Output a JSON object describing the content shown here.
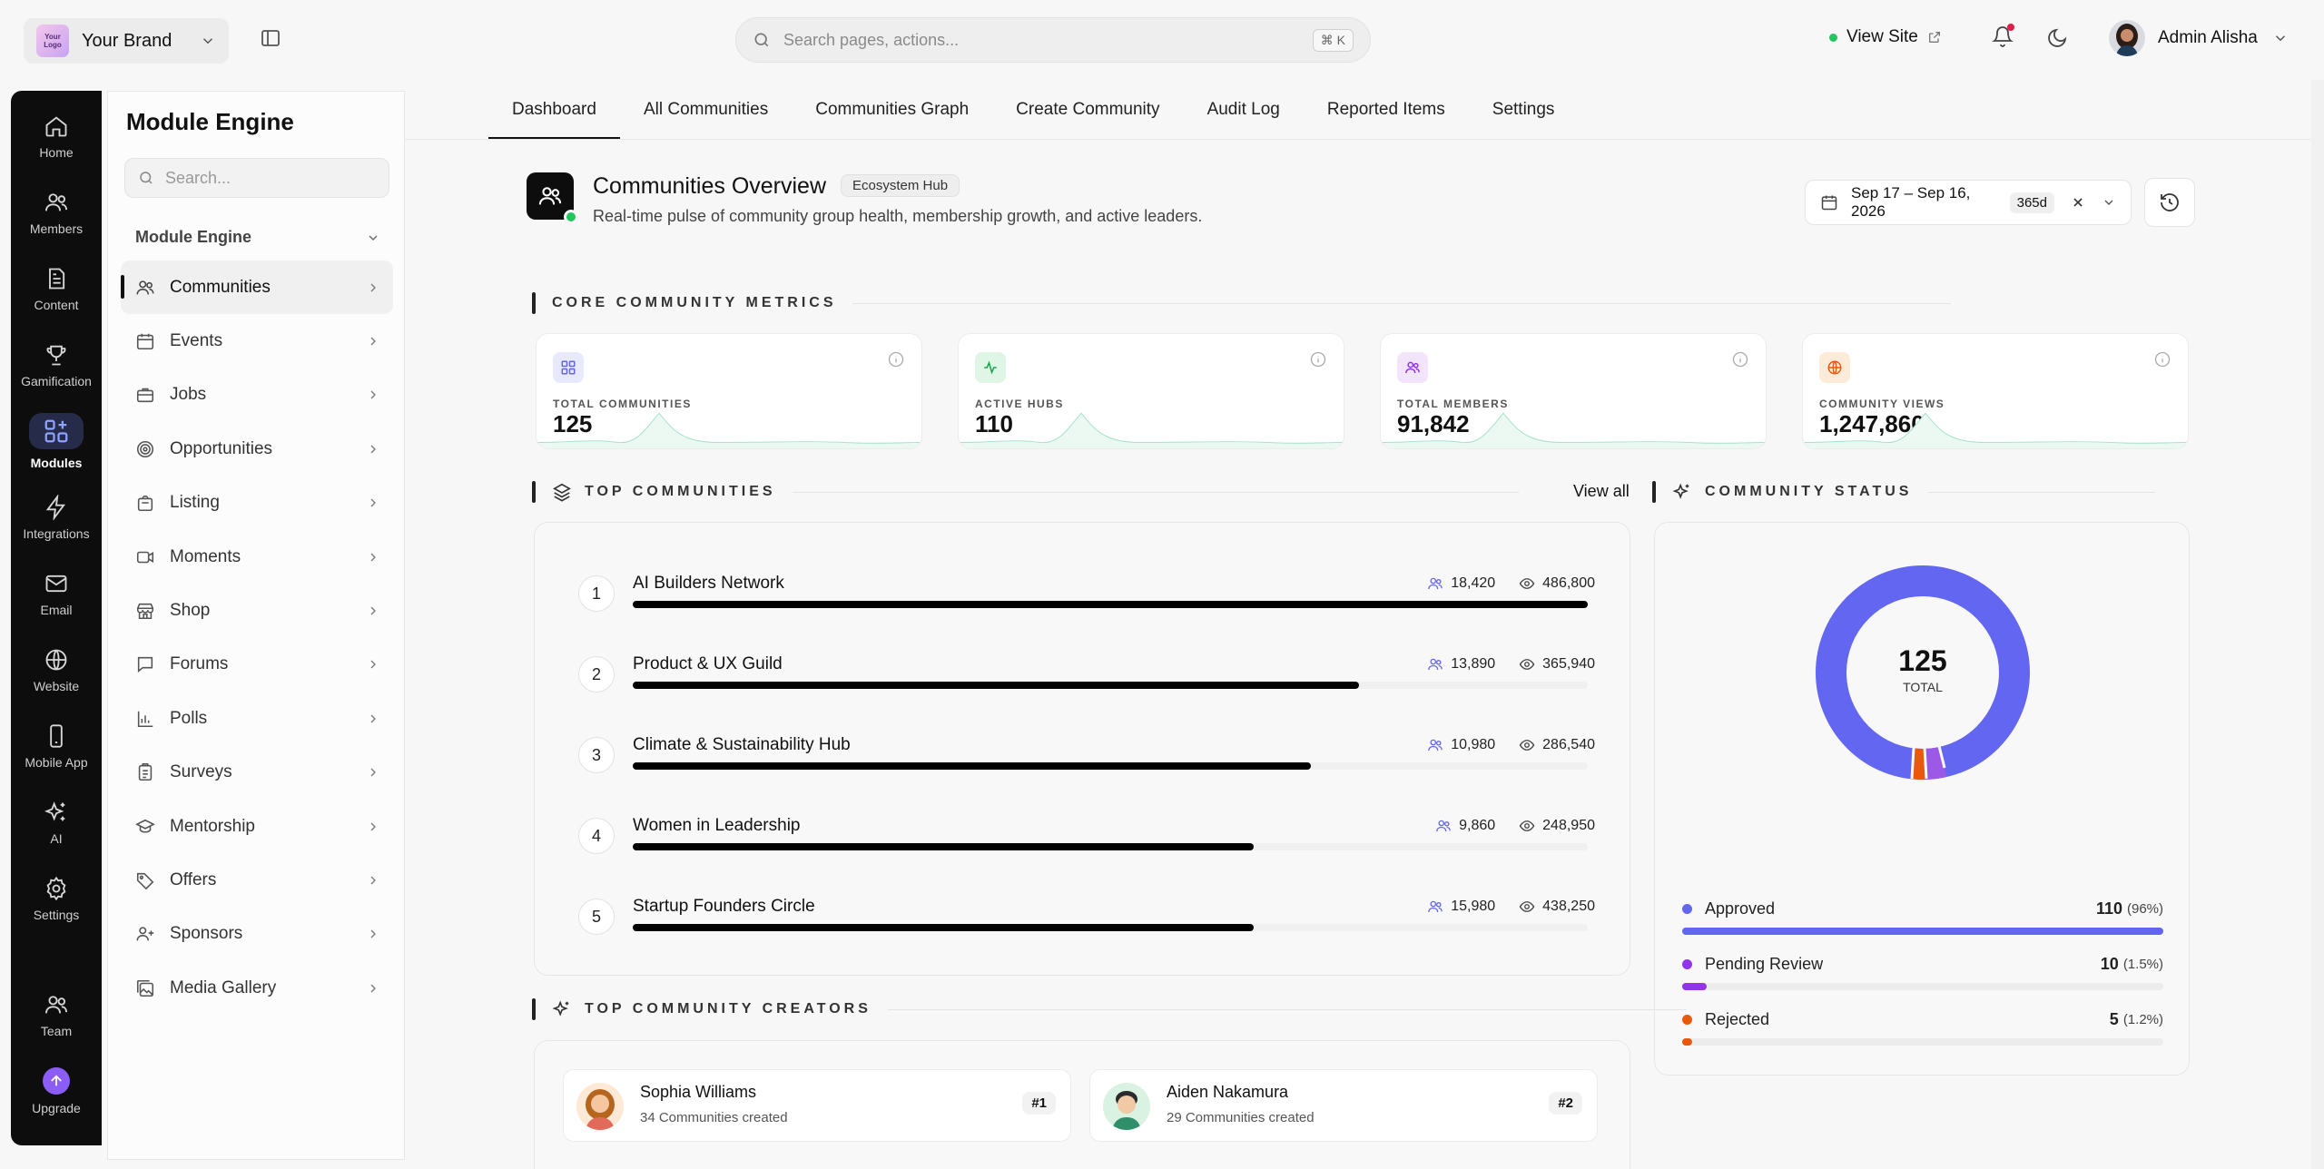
{
  "topbar": {
    "brand_logo_text": "Your Logo",
    "brand_name": "Your Brand",
    "search_placeholder": "Search pages, actions...",
    "search_shortcut": "⌘ K",
    "view_site": "View Site",
    "user_name": "Admin Alisha"
  },
  "rail": {
    "items": [
      {
        "label": "Home",
        "icon": "home-icon"
      },
      {
        "label": "Members",
        "icon": "members-icon"
      },
      {
        "label": "Content",
        "icon": "content-icon"
      },
      {
        "label": "Gamification",
        "icon": "trophy-icon"
      },
      {
        "label": "Modules",
        "icon": "modules-icon",
        "active": true
      },
      {
        "label": "Integrations",
        "icon": "bolt-icon"
      },
      {
        "label": "Email",
        "icon": "mail-icon"
      },
      {
        "label": "Website",
        "icon": "globe-icon"
      },
      {
        "label": "Mobile App",
        "icon": "phone-icon"
      },
      {
        "label": "AI",
        "icon": "sparkles-icon"
      },
      {
        "label": "Settings",
        "icon": "gear-icon"
      }
    ],
    "team": "Team",
    "upgrade": "Upgrade"
  },
  "module_panel": {
    "title": "Module Engine",
    "search_placeholder": "Search...",
    "section": "Module Engine",
    "items": [
      {
        "label": "Communities",
        "active": true
      },
      {
        "label": "Events"
      },
      {
        "label": "Jobs"
      },
      {
        "label": "Opportunities"
      },
      {
        "label": "Listing"
      },
      {
        "label": "Moments"
      },
      {
        "label": "Shop"
      },
      {
        "label": "Forums"
      },
      {
        "label": "Polls"
      },
      {
        "label": "Surveys"
      },
      {
        "label": "Mentorship"
      },
      {
        "label": "Offers"
      },
      {
        "label": "Sponsors"
      },
      {
        "label": "Media Gallery"
      }
    ]
  },
  "tabs": [
    "Dashboard",
    "All Communities",
    "Communities Graph",
    "Create Community",
    "Audit Log",
    "Reported Items",
    "Settings"
  ],
  "overview": {
    "title": "Communities Overview",
    "badge": "Ecosystem Hub",
    "subtitle": "Real-time pulse of community group health, membership growth, and active leaders.",
    "date_range": "Sep 17 – Sep 16, 2026",
    "days": "365d"
  },
  "sections": {
    "core": "CORE COMMUNITY METRICS",
    "top": "TOP COMMUNITIES",
    "status": "COMMUNITY STATUS",
    "creators": "TOP COMMUNITY CREATORS",
    "view_all": "View all"
  },
  "metrics": [
    {
      "label": "TOTAL COMMUNITIES",
      "value": "125",
      "icon": "grid-icon",
      "color": "#6366f1",
      "bg": "#e8e9fd"
    },
    {
      "label": "ACTIVE HUBS",
      "value": "110",
      "icon": "activity-icon",
      "color": "#16a34a",
      "bg": "#dff5e6"
    },
    {
      "label": "TOTAL MEMBERS",
      "value": "91,842",
      "icon": "users-icon",
      "color": "#9333ea",
      "bg": "#f1e4fb"
    },
    {
      "label": "COMMUNITY VIEWS",
      "value": "1,247,860",
      "icon": "globe-icon",
      "color": "#ea580c",
      "bg": "#fdebd9"
    }
  ],
  "top_communities": [
    {
      "rank": "1",
      "name": "AI Builders Network",
      "members": "18,420",
      "views": "486,800",
      "pct": 100
    },
    {
      "rank": "2",
      "name": "Product & UX Guild",
      "members": "13,890",
      "views": "365,940",
      "pct": 76
    },
    {
      "rank": "3",
      "name": "Climate & Sustainability Hub",
      "members": "10,980",
      "views": "286,540",
      "pct": 71
    },
    {
      "rank": "4",
      "name": "Women in Leadership",
      "members": "9,860",
      "views": "248,950",
      "pct": 65
    },
    {
      "rank": "5",
      "name": "Startup Founders Circle",
      "members": "15,980",
      "views": "438,250",
      "pct": 65
    }
  ],
  "status": {
    "total": "125",
    "total_label": "TOTAL",
    "items": [
      {
        "label": "Approved",
        "value": "110",
        "pct": "(96%)",
        "color": "#6366f1",
        "fill": 100
      },
      {
        "label": "Pending Review",
        "value": "10",
        "pct": "(1.5%)",
        "color": "#9333ea",
        "fill": 5
      },
      {
        "label": "Rejected",
        "value": "5",
        "pct": "(1.2%)",
        "color": "#ea580c",
        "fill": 2
      }
    ]
  },
  "creators": [
    {
      "name": "Sophia Williams",
      "sub": "34 Communities created",
      "rank": "#1"
    },
    {
      "name": "Aiden Nakamura",
      "sub": "29 Communities created",
      "rank": "#2"
    }
  ]
}
